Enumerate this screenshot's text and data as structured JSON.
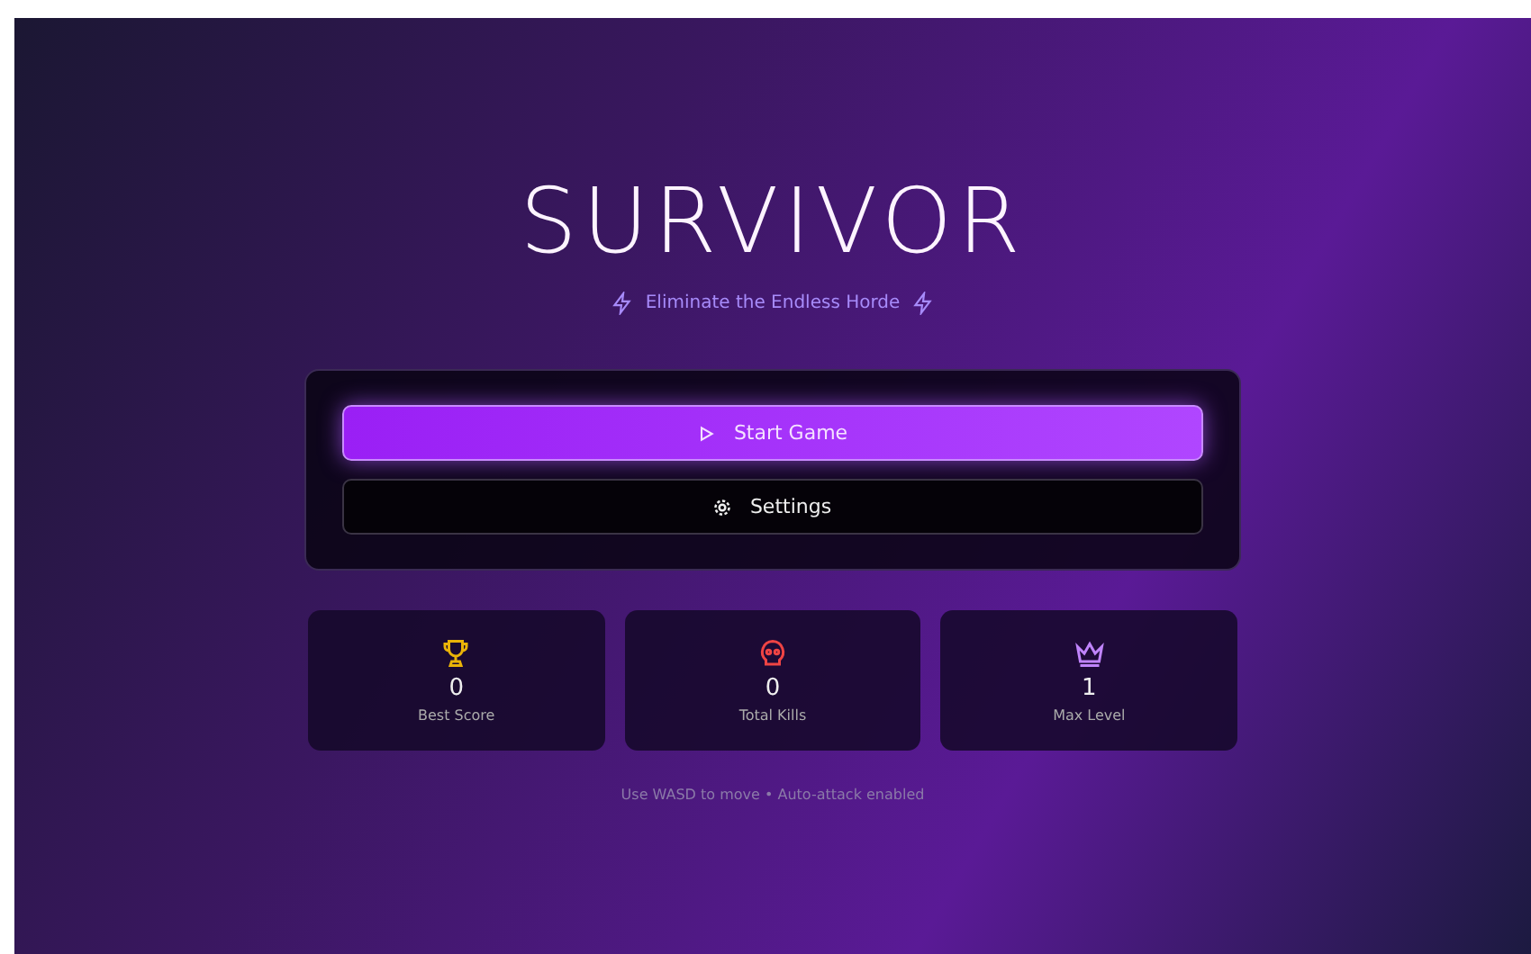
{
  "title": "SURVIVOR",
  "subtitle": "Eliminate the Endless Horde",
  "buttons": [
    {
      "label": "Start Game",
      "kind": "primary"
    },
    {
      "label": "Settings",
      "kind": "secondary"
    }
  ],
  "stats": [
    {
      "kind": "trophy",
      "value": "0",
      "label": "Best Score",
      "color": "#eab308"
    },
    {
      "kind": "skull",
      "value": "0",
      "label": "Total Kills",
      "color": "#ef4444"
    },
    {
      "kind": "crown",
      "value": "1",
      "label": "Max Level",
      "color": "#c084fc"
    }
  ],
  "hint": "Use WASD to move • Auto-attack enabled"
}
